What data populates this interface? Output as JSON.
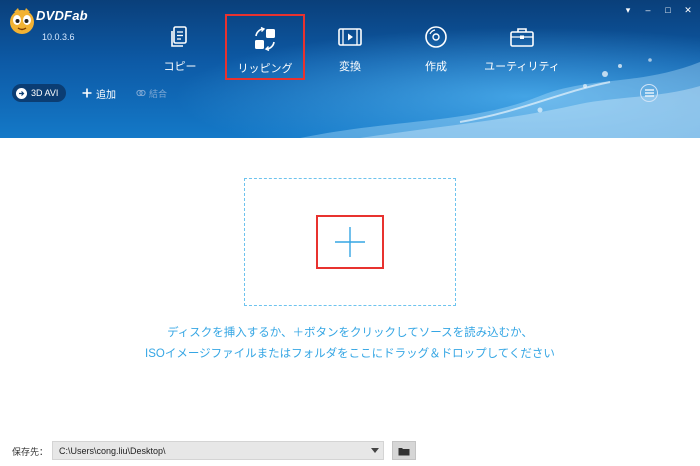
{
  "app": {
    "brand_name": "DVDFab",
    "version": "10.0.3.6"
  },
  "window_controls": {
    "pin": "▾",
    "minimize": "–",
    "restore": "□",
    "close": "✕"
  },
  "nav": {
    "items": [
      {
        "label": "コピー",
        "icon": "copy-document-icon",
        "selected": false
      },
      {
        "label": "リッピング",
        "icon": "ripper-arrows-icon",
        "selected": true
      },
      {
        "label": "変換",
        "icon": "film-strip-icon",
        "selected": false
      },
      {
        "label": "作成",
        "icon": "disc-icon",
        "selected": false
      },
      {
        "label": "ユーティリティ",
        "icon": "toolbox-icon",
        "selected": false
      }
    ]
  },
  "toolbar": {
    "mode_label": "3D AVI",
    "add_label": "追加",
    "merge_label": "結合"
  },
  "main": {
    "hint_line1": "ディスクを挿入するか、＋ボタンをクリックしてソースを読み込むか、",
    "hint_line2": "ISOイメージファイルまたはフォルダをここにドラッグ＆ドロップしてください"
  },
  "footer": {
    "save_label": "保存先：",
    "save_path": "C:\\Users\\cong.liu\\Desktop\\"
  },
  "colors": {
    "header_dark": "#0a3f7a",
    "header_light": "#1479c8",
    "highlight_red": "#e8322f",
    "accent_blue": "#35a6e4"
  }
}
